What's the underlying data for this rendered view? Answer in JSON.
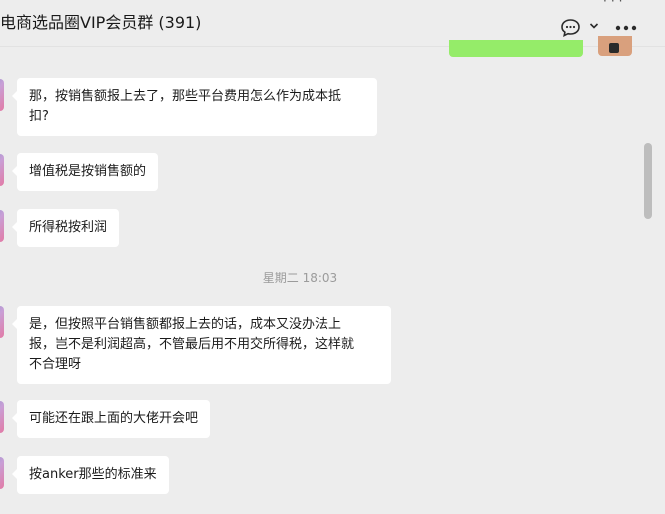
{
  "header": {
    "title": "电商选品圈VIP会员群 (391)",
    "top_dots": "···",
    "icons": [
      "chat-bubble-icon",
      "chevron-down-icon",
      "more-icon"
    ]
  },
  "messages": [
    {
      "text_lines": [
        "那，按销售额报上去了，那些平台费用怎么作为成本抵",
        "扣?"
      ]
    },
    {
      "text_lines": [
        "增值税是按销售额的"
      ]
    },
    {
      "text_lines": [
        "所得税按利润"
      ]
    },
    {
      "text_lines": [
        "是，但按照平台销售额都报上去的话，成本又没办法上",
        "报，岂不是利润超高，不管最后用不用交所得税，这样就",
        "不合理呀"
      ]
    },
    {
      "text_lines": [
        "可能还在跟上面的大佬开会吧"
      ]
    },
    {
      "text_lines": [
        "按anker那些的标准来"
      ]
    }
  ],
  "timestamp": "星期二 18:03",
  "colors": {
    "background": "#ededed",
    "bubble_other": "#ffffff",
    "bubble_self": "#95ec69",
    "timestamp": "#9b9b9b"
  }
}
